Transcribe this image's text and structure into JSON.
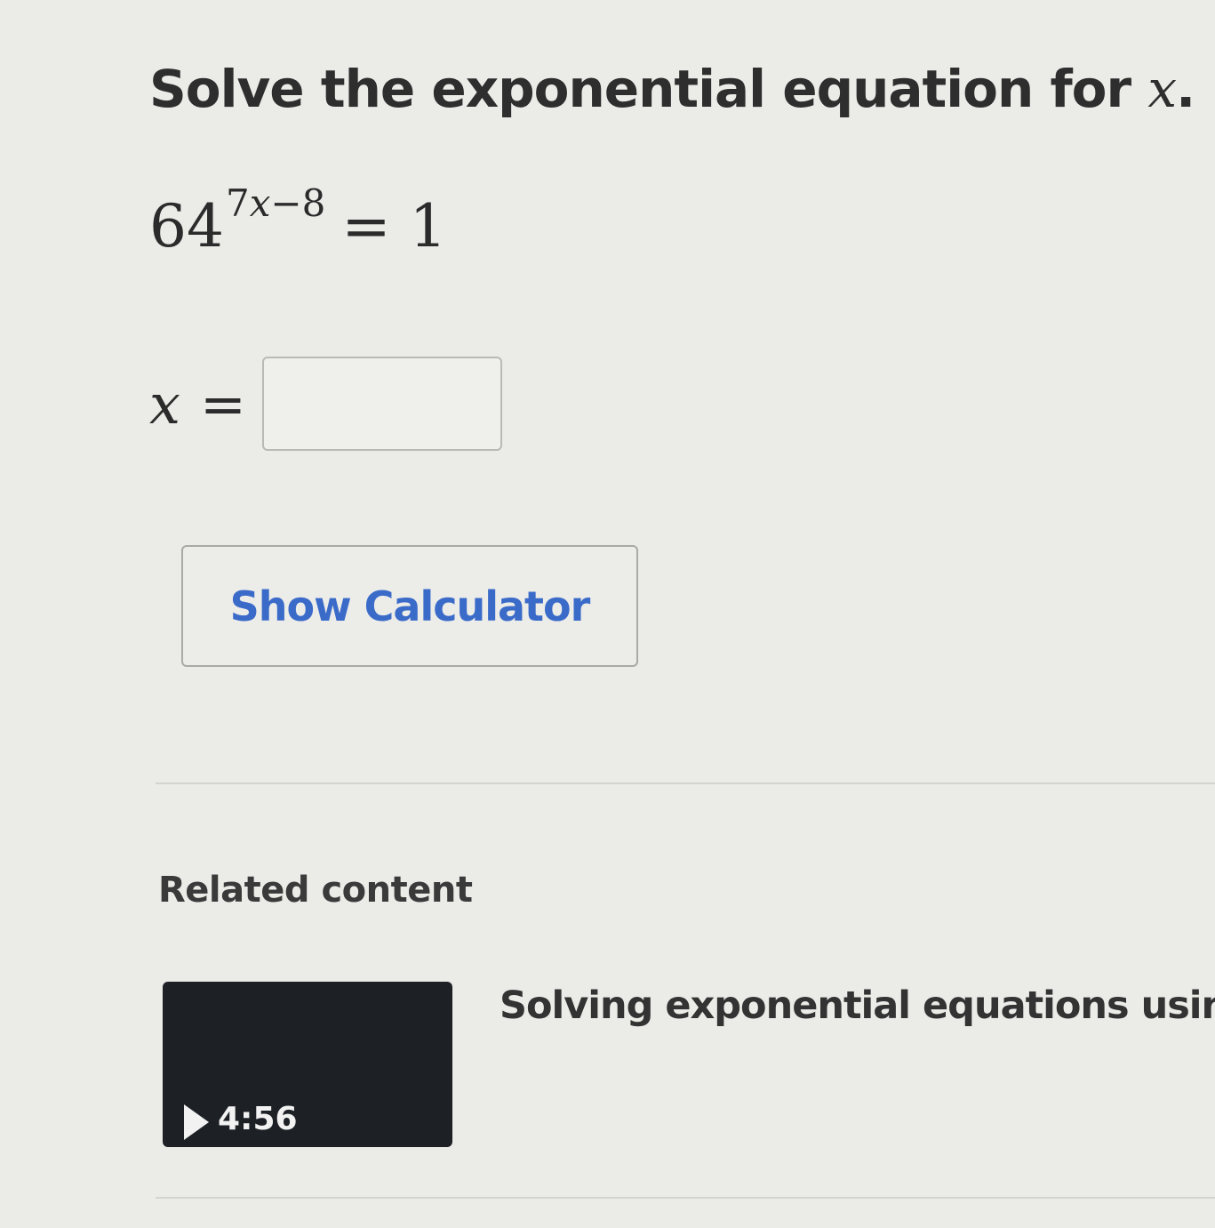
{
  "question": {
    "prompt_text": "Solve the exponential equation for ",
    "prompt_var": "x",
    "prompt_end": ".",
    "equation": {
      "base": "64",
      "exponent_coef": "7",
      "exponent_var": "x",
      "exponent_rest": "−8",
      "equals": "=",
      "rhs": "1"
    },
    "answer": {
      "var": "x",
      "equals": "=",
      "value": ""
    }
  },
  "calculator_button": {
    "label": "Show Calculator"
  },
  "related": {
    "heading": "Related content",
    "items": [
      {
        "duration": "4:56",
        "title": "Solving exponential equations using"
      }
    ]
  }
}
